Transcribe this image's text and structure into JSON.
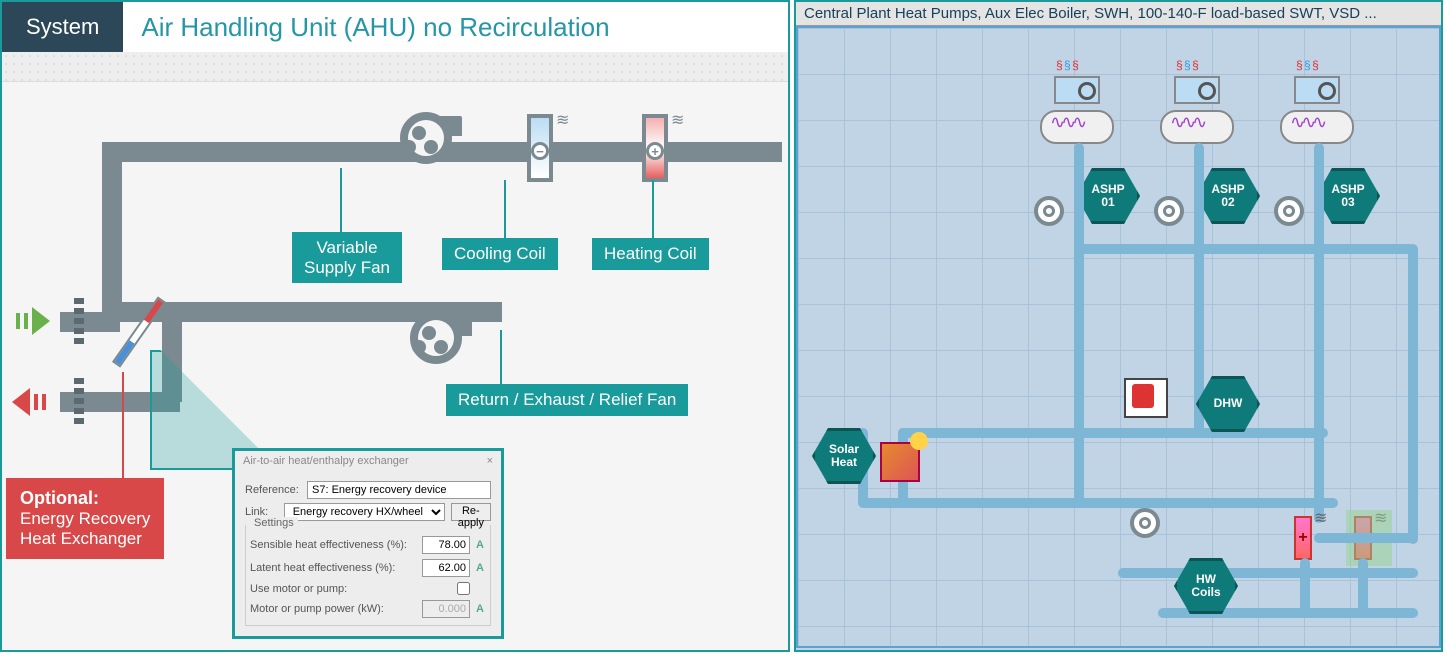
{
  "left": {
    "system_tag": "System",
    "title": "Air Handling Unit (AHU) no Recirculation",
    "labels": {
      "supply_fan": "Variable\nSupply Fan",
      "cooling_coil": "Cooling Coil",
      "heating_coil": "Heating Coil",
      "return_fan": "Return / Exhaust / Relief Fan",
      "optional_title": "Optional:",
      "optional_body": "Energy Recovery\nHeat Exchanger"
    },
    "dialog": {
      "title": "Air-to-air heat/enthalpy exchanger",
      "reference_label": "Reference:",
      "reference_value": "S7: Energy recovery device",
      "link_label": "Link:",
      "link_value": "Energy recovery HX/wheel",
      "reapply": "Re-apply",
      "settings_title": "Settings",
      "sensible_label": "Sensible heat effectiveness (%):",
      "sensible_value": "78.00",
      "latent_label": "Latent heat effectiveness (%):",
      "latent_value": "62.00",
      "motor_label": "Use motor or pump:",
      "motor_checked": false,
      "power_label": "Motor or pump power (kW):",
      "power_value": "0.000"
    }
  },
  "right": {
    "title": "Central Plant Heat Pumps, Aux Elec Boiler, SWH, 100-140-F load-based SWT, VSD ...",
    "labels": {
      "ashp1": "ASHP\n01",
      "ashp2": "ASHP\n02",
      "ashp3": "ASHP\n03",
      "dhw": "DHW",
      "solar": "Solar\nHeat",
      "hwcoils": "HW\nCoils"
    }
  }
}
